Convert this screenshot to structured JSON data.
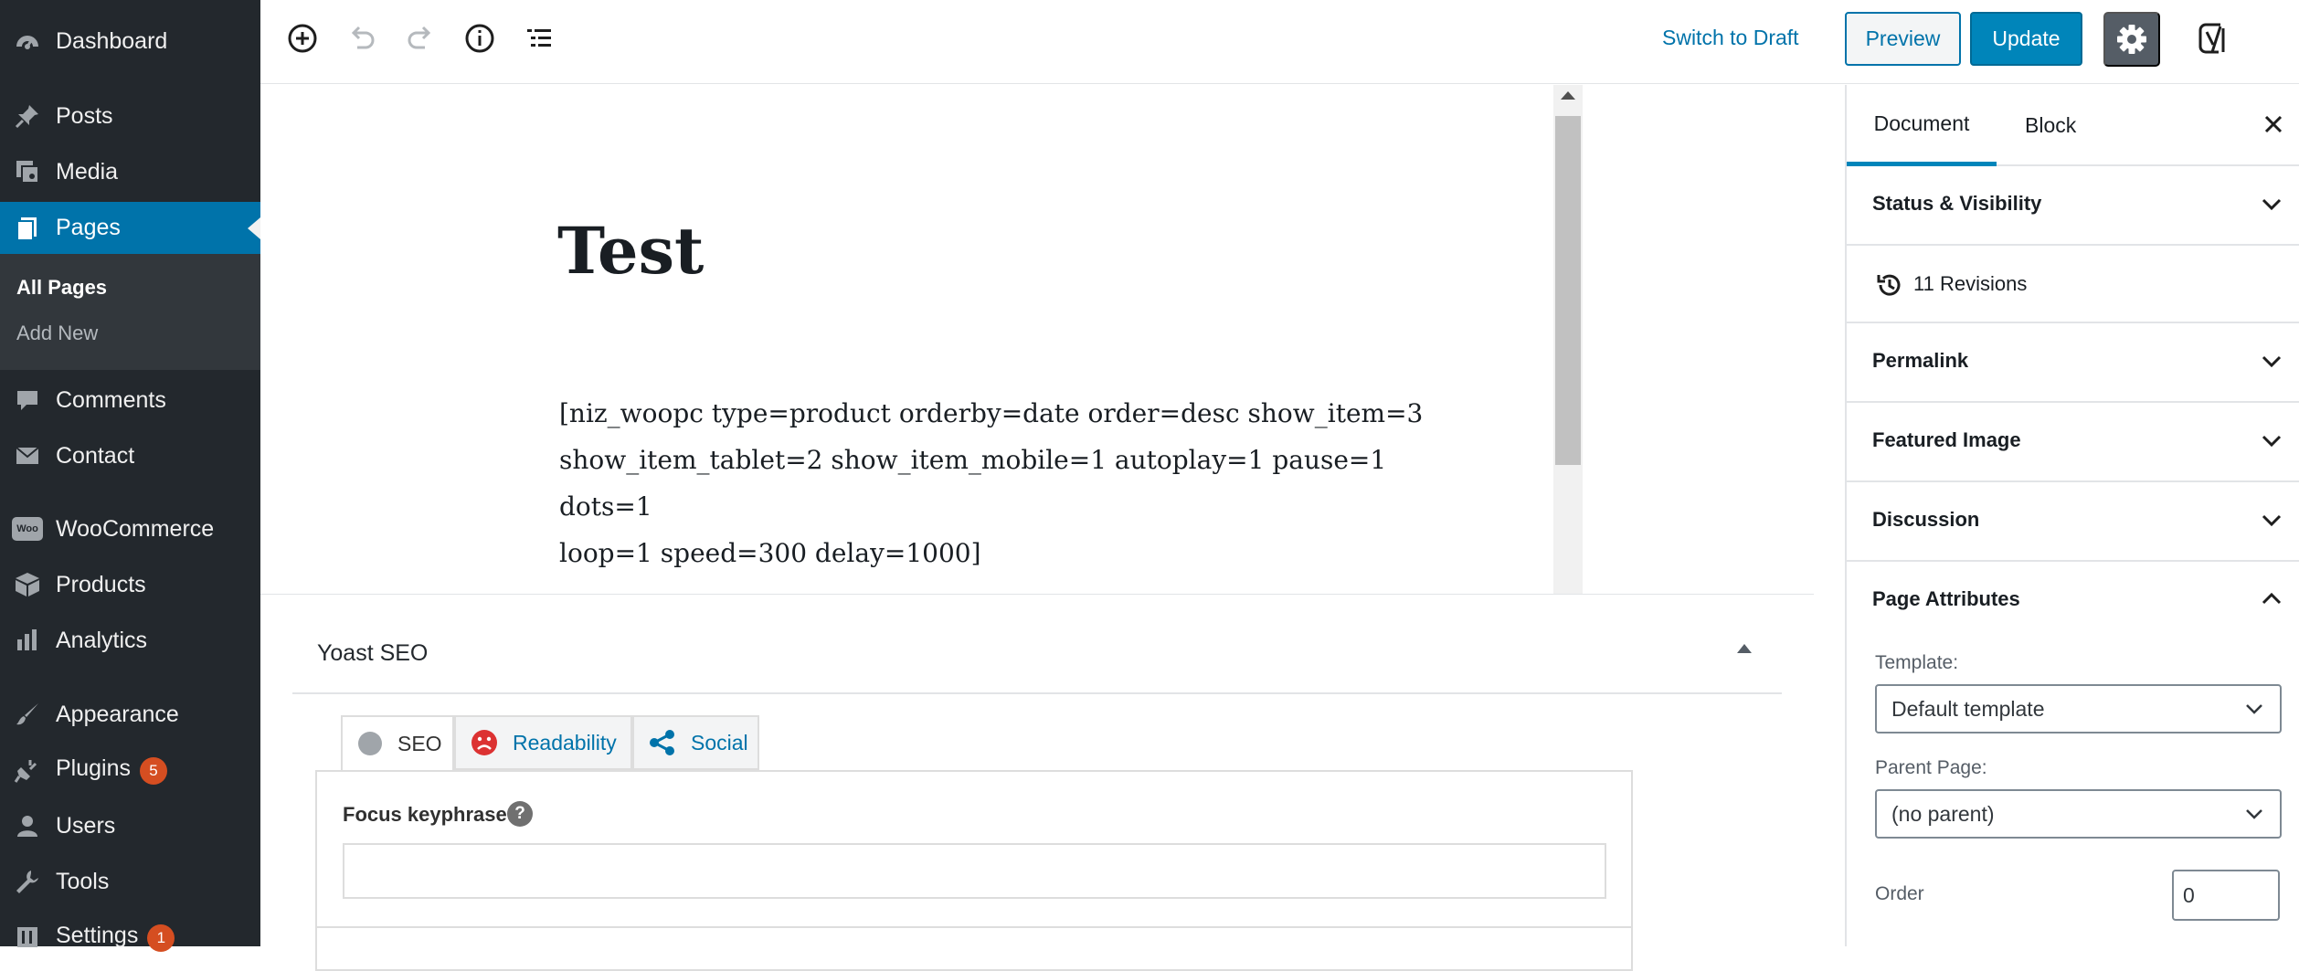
{
  "sidebar": {
    "items": [
      {
        "label": "Dashboard",
        "icon": "dashboard-icon"
      },
      {
        "label": "Posts",
        "icon": "pin-icon"
      },
      {
        "label": "Media",
        "icon": "media-icon"
      },
      {
        "label": "Pages",
        "icon": "pages-icon"
      },
      {
        "label": "Comments",
        "icon": "comment-icon"
      },
      {
        "label": "Contact",
        "icon": "mail-icon"
      },
      {
        "label": "WooCommerce",
        "icon": "woocommerce-icon"
      },
      {
        "label": "Products",
        "icon": "box-icon"
      },
      {
        "label": "Analytics",
        "icon": "bar-chart-icon"
      },
      {
        "label": "Appearance",
        "icon": "paintbrush-icon"
      },
      {
        "label": "Plugins",
        "icon": "plug-icon",
        "badge": "5"
      },
      {
        "label": "Users",
        "icon": "user-icon"
      },
      {
        "label": "Tools",
        "icon": "wrench-icon"
      },
      {
        "label": "Settings",
        "icon": "settings-icon",
        "badge": "1"
      }
    ],
    "submenu": [
      "All Pages",
      "Add New"
    ],
    "woo_badge": "Woo"
  },
  "toolbar": {
    "switch_draft": "Switch to Draft",
    "preview": "Preview",
    "update": "Update"
  },
  "editor": {
    "title": "Test",
    "shortcode_lines": [
      " [niz_woopc type=product orderby=date order=desc show_item=3",
      "show_item_tablet=2 show_item_mobile=1 autoplay=1 pause=1 dots=1",
      "loop=1 speed=300 delay=1000]"
    ]
  },
  "yoast": {
    "title": "Yoast SEO",
    "tabs": [
      "SEO",
      "Readability",
      "Social"
    ],
    "focus_label": "Focus keyphrase",
    "help": "?",
    "focus_value": ""
  },
  "settings": {
    "tabs": [
      "Document",
      "Block"
    ],
    "panels": {
      "status": "Status & Visibility",
      "revisions": "11 Revisions",
      "permalink": "Permalink",
      "featured": "Featured Image",
      "discussion": "Discussion",
      "attributes": "Page Attributes"
    },
    "template_label": "Template:",
    "template_value": "Default template",
    "parent_label": "Parent Page:",
    "parent_value": "(no parent)",
    "order_label": "Order",
    "order_value": "0"
  },
  "colors": {
    "admin_bg": "#23282d",
    "accent": "#0073aa",
    "button_primary": "#0085ba",
    "badge": "#d54e21"
  }
}
